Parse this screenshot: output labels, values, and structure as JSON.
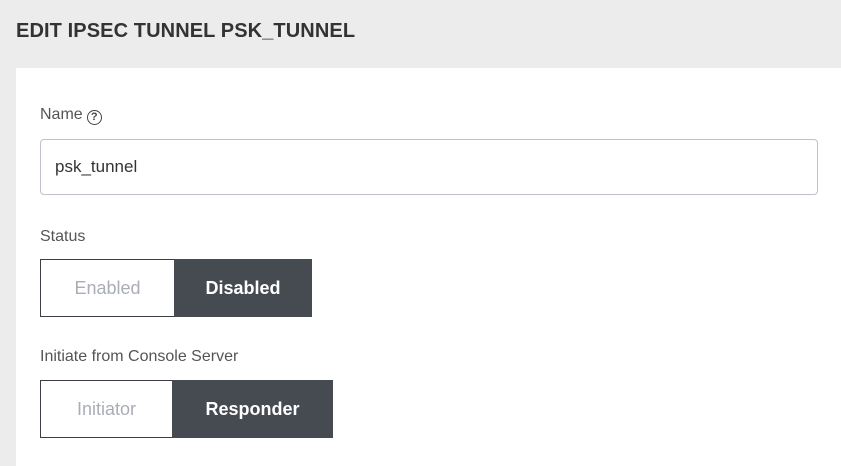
{
  "header": {
    "title": "EDIT IPSEC TUNNEL PSK_TUNNEL"
  },
  "form": {
    "name": {
      "label": "Name",
      "help_icon": "question-circle-icon",
      "help_glyph": "?",
      "value": "psk_tunnel"
    },
    "status": {
      "label": "Status",
      "options": [
        "Enabled",
        "Disabled"
      ],
      "selected": "Disabled"
    },
    "initiate": {
      "label": "Initiate from Console Server",
      "options": [
        "Initiator",
        "Responder"
      ],
      "selected": "Responder"
    }
  },
  "colors": {
    "header_bg": "#ececec",
    "toggle_active_bg": "#464a51",
    "toggle_inactive_text": "#a9adb6"
  }
}
